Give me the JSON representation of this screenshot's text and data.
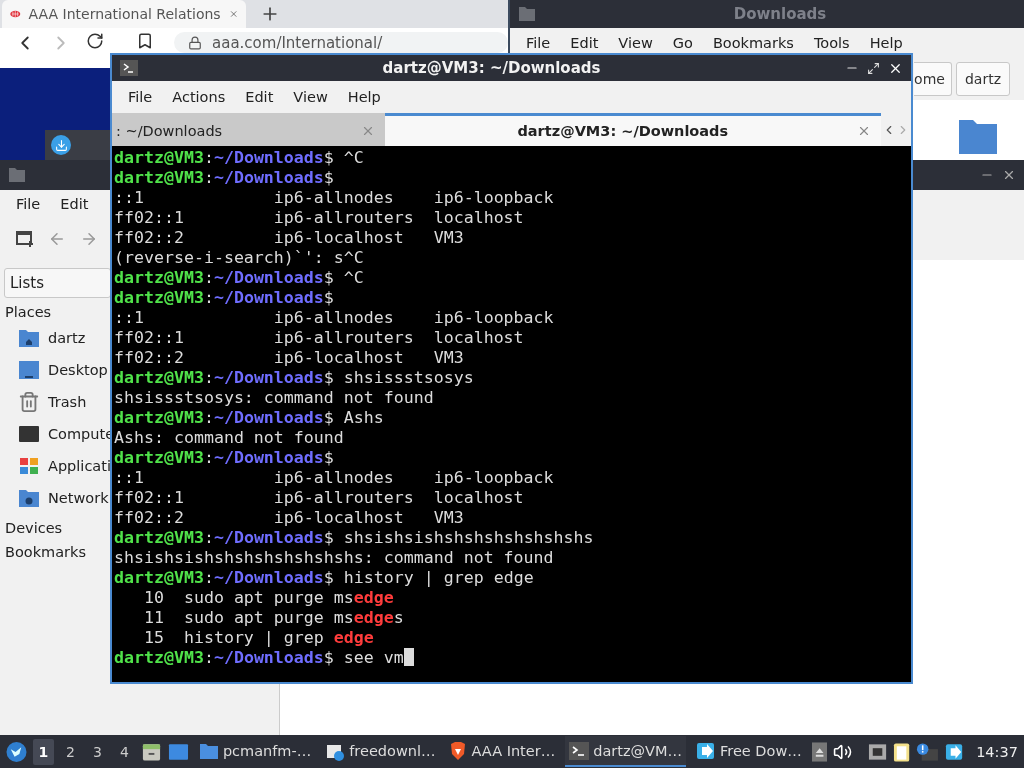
{
  "browser": {
    "tab": {
      "title": "AAA International Relations",
      "selected": true
    },
    "url": "aaa.com/International/",
    "forward_disabled": true
  },
  "file_manager_back": {
    "title": "Downloads",
    "menu": [
      "File",
      "Edit",
      "View",
      "Go",
      "Bookmarks",
      "Tools",
      "Help"
    ],
    "path_buttons": [
      "ome",
      "dartz"
    ]
  },
  "file_manager": {
    "menu": [
      "File",
      "Edit"
    ],
    "side_pane": "Lists",
    "sections": [
      {
        "title": "Places",
        "items": [
          {
            "label": "dartz",
            "kind": "home"
          },
          {
            "label": "Desktop",
            "kind": "desktop"
          },
          {
            "label": "Trash",
            "kind": "trash"
          },
          {
            "label": "Compute",
            "kind": "computer"
          },
          {
            "label": "Applicati",
            "kind": "apps"
          },
          {
            "label": "Network",
            "kind": "network"
          }
        ]
      },
      {
        "title": "Devices"
      },
      {
        "title": "Bookmarks"
      }
    ]
  },
  "terminal": {
    "title": "dartz@VM3: ~/Downloads",
    "menu": [
      "File",
      "Actions",
      "Edit",
      "View",
      "Help"
    ],
    "tabs": [
      {
        "label": ": ~/Downloads",
        "selected": false
      },
      {
        "label": "dartz@VM3: ~/Downloads",
        "selected": true
      }
    ],
    "cursor": true,
    "lines": [
      [
        {
          "text": "dartz@VM3",
          "kind": "user"
        },
        {
          "text": ":",
          "kind": "plain"
        },
        {
          "text": "~/Downloads",
          "kind": "path"
        },
        {
          "text": "$ ^C",
          "kind": "plain"
        }
      ],
      [
        {
          "text": "dartz@VM3",
          "kind": "user"
        },
        {
          "text": ":",
          "kind": "plain"
        },
        {
          "text": "~/Downloads",
          "kind": "path"
        },
        {
          "text": "$",
          "kind": "plain"
        }
      ],
      [
        {
          "text": "::1             ip6-allnodes    ip6-loopback",
          "kind": "plain"
        }
      ],
      [
        {
          "text": "ff02::1         ip6-allrouters  localhost",
          "kind": "plain"
        }
      ],
      [
        {
          "text": "ff02::2         ip6-localhost   VM3",
          "kind": "plain"
        }
      ],
      [
        {
          "text": "(reverse-i-search)`': s^C",
          "kind": "plain"
        }
      ],
      [
        {
          "text": "dartz@VM3",
          "kind": "user"
        },
        {
          "text": ":",
          "kind": "plain"
        },
        {
          "text": "~/Downloads",
          "kind": "path"
        },
        {
          "text": "$ ^C",
          "kind": "plain"
        }
      ],
      [
        {
          "text": "dartz@VM3",
          "kind": "user"
        },
        {
          "text": ":",
          "kind": "plain"
        },
        {
          "text": "~/Downloads",
          "kind": "path"
        },
        {
          "text": "$",
          "kind": "plain"
        }
      ],
      [
        {
          "text": "::1             ip6-allnodes    ip6-loopback",
          "kind": "plain"
        }
      ],
      [
        {
          "text": "ff02::1         ip6-allrouters  localhost",
          "kind": "plain"
        }
      ],
      [
        {
          "text": "ff02::2         ip6-localhost   VM3",
          "kind": "plain"
        }
      ],
      [
        {
          "text": "dartz@VM3",
          "kind": "user"
        },
        {
          "text": ":",
          "kind": "plain"
        },
        {
          "text": "~/Downloads",
          "kind": "path"
        },
        {
          "text": "$ shsissstsosys",
          "kind": "plain"
        }
      ],
      [
        {
          "text": "shsissstsosys: command not found",
          "kind": "plain"
        }
      ],
      [
        {
          "text": "dartz@VM3",
          "kind": "user"
        },
        {
          "text": ":",
          "kind": "plain"
        },
        {
          "text": "~/Downloads",
          "kind": "path"
        },
        {
          "text": "$ Ashs",
          "kind": "plain"
        }
      ],
      [
        {
          "text": "Ashs: command not found",
          "kind": "plain"
        }
      ],
      [
        {
          "text": "dartz@VM3",
          "kind": "user"
        },
        {
          "text": ":",
          "kind": "plain"
        },
        {
          "text": "~/Downloads",
          "kind": "path"
        },
        {
          "text": "$",
          "kind": "plain"
        }
      ],
      [
        {
          "text": "::1             ip6-allnodes    ip6-loopback",
          "kind": "plain"
        }
      ],
      [
        {
          "text": "ff02::1         ip6-allrouters  localhost",
          "kind": "plain"
        }
      ],
      [
        {
          "text": "ff02::2         ip6-localhost   VM3",
          "kind": "plain"
        }
      ],
      [
        {
          "text": "dartz@VM3",
          "kind": "user"
        },
        {
          "text": ":",
          "kind": "plain"
        },
        {
          "text": "~/Downloads",
          "kind": "path"
        },
        {
          "text": "$ shsishsishshshshshshshshs",
          "kind": "plain"
        }
      ],
      [
        {
          "text": "shsishsishshshshshshshshs: command not found",
          "kind": "plain"
        }
      ],
      [
        {
          "text": "dartz@VM3",
          "kind": "user"
        },
        {
          "text": ":",
          "kind": "plain"
        },
        {
          "text": "~/Downloads",
          "kind": "path"
        },
        {
          "text": "$ history | grep edge",
          "kind": "plain"
        }
      ],
      [
        {
          "text": "   10  sudo apt purge ms",
          "kind": "plain"
        },
        {
          "text": "edge",
          "kind": "match"
        }
      ],
      [
        {
          "text": "   11  sudo apt purge ms",
          "kind": "plain"
        },
        {
          "text": "edge",
          "kind": "match"
        },
        {
          "text": "s",
          "kind": "plain"
        }
      ],
      [
        {
          "text": "   15  history | grep ",
          "kind": "plain"
        },
        {
          "text": "edge",
          "kind": "match"
        }
      ],
      [
        {
          "text": "dartz@VM3",
          "kind": "user"
        },
        {
          "text": ":",
          "kind": "plain"
        },
        {
          "text": "~/Downloads",
          "kind": "path"
        },
        {
          "text": "$ see vm",
          "kind": "plain"
        }
      ]
    ]
  },
  "taskbar": {
    "workspaces": [
      {
        "label": "1",
        "selected": true
      },
      {
        "label": "2",
        "selected": false
      },
      {
        "label": "3",
        "selected": false
      },
      {
        "label": "4",
        "selected": false
      }
    ],
    "tasks": [
      {
        "label": "pcmanfm-…",
        "kind": "folder",
        "selected": false
      },
      {
        "label": "freedownl…",
        "kind": "download",
        "selected": false
      },
      {
        "label": "AAA Inter…",
        "kind": "browser",
        "selected": false
      },
      {
        "label": "dartz@VM…",
        "kind": "terminal",
        "selected": true
      },
      {
        "label": "Free Dow…",
        "kind": "freedownload",
        "selected": false
      }
    ],
    "clock": "14:37"
  }
}
